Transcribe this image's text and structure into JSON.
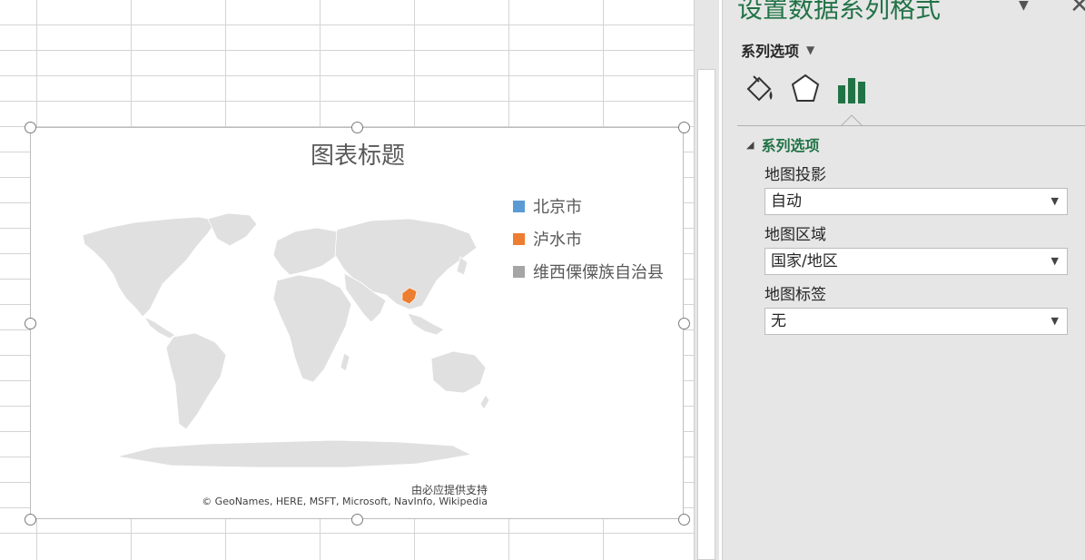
{
  "chart": {
    "title": "图表标题",
    "legend": [
      {
        "label": "北京市",
        "color": "#5b9bd5"
      },
      {
        "label": "泸水市",
        "color": "#ed7d31"
      },
      {
        "label": "维西傈僳族自治县",
        "color": "#a5a5a5"
      }
    ],
    "credit_line1": "由必应提供支持",
    "credit_line2": "© GeoNames, HERE, MSFT, Microsoft, NavInfo, Wikipedia"
  },
  "pane": {
    "title": "设置数据系列格式",
    "series_options_label": "系列选项",
    "tabs": [
      "fill-line-icon",
      "effects-icon",
      "series-options-icon"
    ],
    "section_title": "系列选项",
    "fields": [
      {
        "label": "地图投影",
        "value": "自动"
      },
      {
        "label": "地图区域",
        "value": "国家/地区"
      },
      {
        "label": "地图标签",
        "value": "无"
      }
    ]
  },
  "colors": {
    "accent": "#217346",
    "map_land": "#e0e0e0",
    "highlight": "#ed7d31"
  }
}
